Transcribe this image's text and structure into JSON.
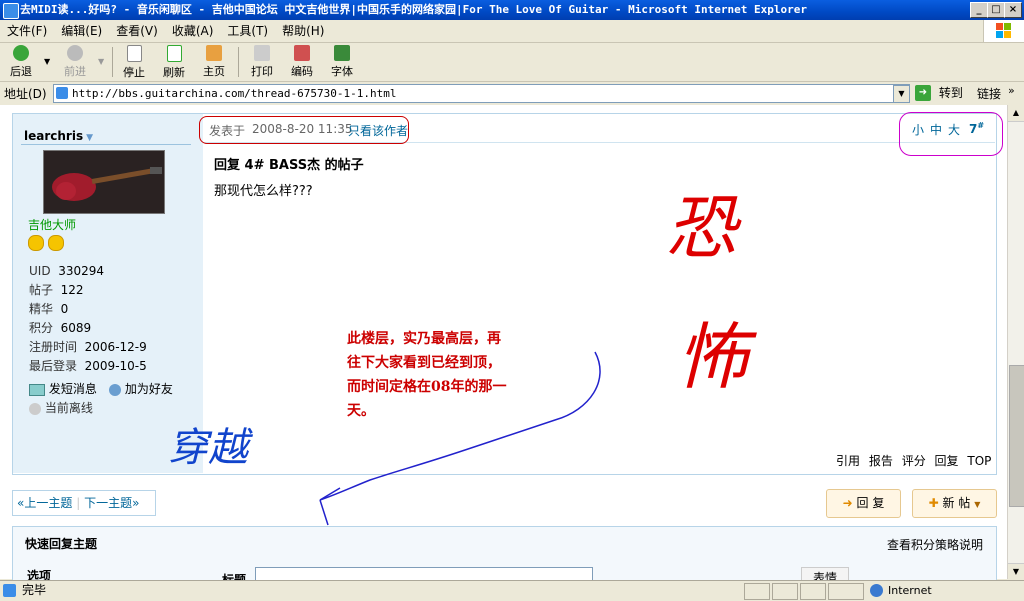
{
  "window": {
    "title": "去MIDI读...好吗? - 音乐闲聊区 - 吉他中国论坛 中文吉他世界|中国乐手的网络家园|For The Love Of Guitar - Microsoft Internet Explorer"
  },
  "menu": [
    "文件(F)",
    "编辑(E)",
    "查看(V)",
    "收藏(A)",
    "工具(T)",
    "帮助(H)"
  ],
  "toolbar": {
    "back": "后退",
    "forward": "前进",
    "stop": "停止",
    "refresh": "刷新",
    "home": "主页",
    "print": "打印",
    "encoding": "编码",
    "font": "字体"
  },
  "address": {
    "label": "地址(D)",
    "url": "http://bbs.guitarchina.com/thread-675730-1-1.html",
    "go": "转到",
    "links": "链接"
  },
  "user": {
    "name": "learchris",
    "rank": "吉他大师",
    "stats": [
      {
        "label": "UID",
        "value": "330294"
      },
      {
        "label": "帖子",
        "value": "122"
      },
      {
        "label": "精华",
        "value": "0"
      },
      {
        "label": "积分",
        "value": "6089"
      },
      {
        "label": "注册时间",
        "value": "2006-12-9"
      },
      {
        "label": "最后登录",
        "value": "2009-10-5"
      }
    ],
    "send_message": "发短消息",
    "add_friend": "加为好友",
    "status": "当前离线"
  },
  "post": {
    "posted_at_label": "发表于",
    "posted_at": "2008-8-20 11:35",
    "only_author": "只看该作者",
    "font_small": "小",
    "font_mid": "中",
    "font_big": "大",
    "floor": "7",
    "floor_mark": "#",
    "title": "回复  4# BASS杰  的帖子",
    "body": "那现代怎么样???",
    "actions": [
      "引用",
      "报告",
      "评分",
      "回复",
      "TOP"
    ]
  },
  "annotations": {
    "note_line1": "此楼层，实乃最高层，再",
    "note_line2": "往下大家看到已经到顶，",
    "note_line3": "而时间定格在08年的那一",
    "note_line4": "天。",
    "scribble_1": "恐",
    "scribble_2": "怖",
    "scribble_3": "穿越"
  },
  "nav": {
    "prev": "上一主题",
    "next": "下一主题",
    "reply_btn": "回 复",
    "new_btn": "新 帖"
  },
  "quick_reply": {
    "title": "快速回复主题",
    "policy": "查看积分策略说明",
    "options": "选项",
    "subject": "标题",
    "btn": "表情"
  },
  "status": {
    "done": "完毕",
    "zone": "Internet"
  }
}
